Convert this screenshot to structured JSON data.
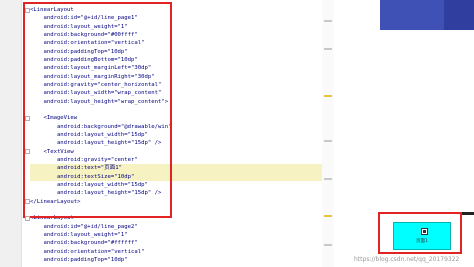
{
  "code_lines": [
    {
      "t": "<LinearLayout"
    },
    {
      "t": "    android:id=\"@+id/line_page1\""
    },
    {
      "t": "    android:layout_weight=\"1\""
    },
    {
      "t": "    android:background=\"#00ffff\""
    },
    {
      "t": "    android:orientation=\"vertical\""
    },
    {
      "t": "    android:paddingTop=\"10dp\""
    },
    {
      "t": "    android:paddingBottom=\"10dp\""
    },
    {
      "t": "    android:layout_marginLeft=\"30dp\""
    },
    {
      "t": "    android:layout_marginRight=\"30dp\""
    },
    {
      "t": "    android:gravity=\"center_horizontal\""
    },
    {
      "t": "    android:layout_width=\"wrap_content\""
    },
    {
      "t": "    android:layout_height=\"wrap_content\">"
    },
    {
      "t": ""
    },
    {
      "t": "    <ImageView"
    },
    {
      "t": "        android:background=\"@drawable/win\""
    },
    {
      "t": "        android:layout_width=\"15dp\""
    },
    {
      "t": "        android:layout_height=\"15dp\" />"
    },
    {
      "t": "    <TextView"
    },
    {
      "t": "        android:gravity=\"center\""
    },
    {
      "t": "        android:text=\"页面1\"",
      "hl": true
    },
    {
      "t": "        android:textSize=\"10dp\"",
      "hl": true
    },
    {
      "t": "        android:layout_width=\"15dp\""
    },
    {
      "t": "        android:layout_height=\"15dp\" />"
    },
    {
      "t": "</LinearLayout>"
    },
    {
      "t": ""
    },
    {
      "t": "<LinearLayout"
    },
    {
      "t": "    android:id=\"@+id/line_page2\""
    },
    {
      "t": "    android:layout_weight=\"1\""
    },
    {
      "t": "    android:background=\"#ffffff\""
    },
    {
      "t": "    android:orientation=\"vertical\""
    },
    {
      "t": "    android:paddingTop=\"10dp\""
    }
  ],
  "preview": {
    "button_label": "页面1"
  },
  "watermark": "https://blog.csdn.net/qq_20179322",
  "colors": {
    "cyan": "#00ffff",
    "highlight": "#e02424",
    "toolbar": "#3f51b5"
  }
}
